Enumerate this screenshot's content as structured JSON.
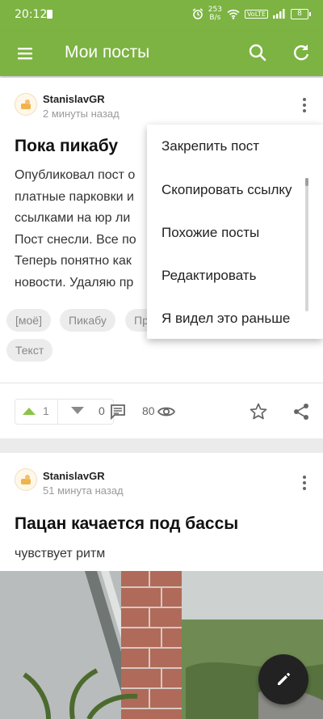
{
  "status_bar": {
    "time": "20:12",
    "speed_value": "253",
    "speed_unit": "B/s",
    "volte": "VoLTE",
    "battery": "8"
  },
  "toolbar": {
    "title": "Мои посты",
    "menu_icon": "hamburger-menu-icon",
    "search_icon": "search-icon",
    "refresh_icon": "refresh-icon"
  },
  "posts": [
    {
      "author": "StanislavGR",
      "time": "2 минуты назад",
      "title": "Пока пикабу",
      "body_lines": [
        "Опубликовал пост о",
        "платные парковки и",
        "ссылками на юр ли",
        "Пост снесли. Все по",
        "Теперь понятно как",
        "новости. Удаляю пр"
      ],
      "tags": [
        "[моё]",
        "Пикабу",
        "Пр",
        "Текст"
      ],
      "votes": "1",
      "comments": "0",
      "views": "80"
    },
    {
      "author": "StanislavGR",
      "time": "51 минута назад",
      "title": "Пацан качается под бассы",
      "body": "чувствует ритм"
    }
  ],
  "popup_menu": {
    "items": [
      "Закрепить пост",
      "Скопировать ссылку",
      "Похожие посты",
      "Редактировать",
      "Я видел это раньше"
    ]
  },
  "fab": {
    "icon": "pencil-icon"
  },
  "colors": {
    "brand_green": "#7cb342",
    "upvote_green": "#8bc34a",
    "fab_dark": "#222222"
  }
}
